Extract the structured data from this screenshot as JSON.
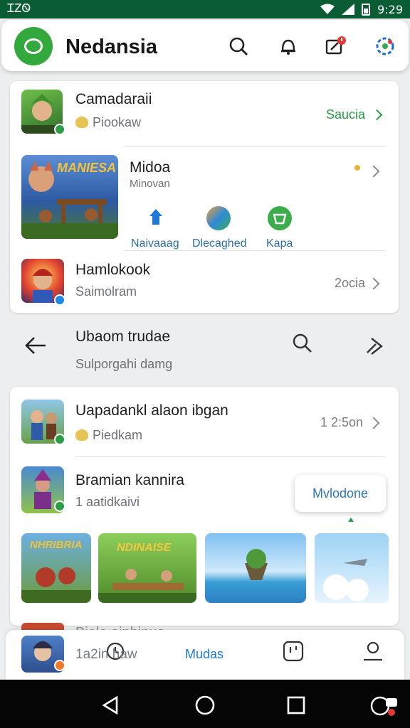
{
  "status": {
    "carrier": "ᏆᏃᏫ",
    "time": "9:29"
  },
  "header": {
    "title": "Nedansia"
  },
  "items": [
    {
      "title": "Camadaraii",
      "subtitle": "Piookaw",
      "action": "Saucia"
    },
    {
      "title": "Midoa",
      "subtitle": "Minovan",
      "actions": [
        "Naivaaag",
        "Dlecaghed",
        "Kapa"
      ],
      "banner": "MANIESA"
    },
    {
      "title": "Hamlokook",
      "subtitle": "Saimolram",
      "meta": "2ocia"
    }
  ],
  "search": {
    "title": "Ubaom trudae",
    "subtitle": "Sulporgahi damg"
  },
  "list2": [
    {
      "title": "Uapadankl alaon ibgan",
      "subtitle": "Piedkam",
      "meta": "1 2:5on"
    },
    {
      "title": "Bramian kannira",
      "subtitle": "1 aatidkaivi"
    }
  ],
  "tooltip": "Mvlodone",
  "gallery": [
    "NHRIBRIA",
    "NDINAISE",
    "",
    ""
  ],
  "partial_item": {
    "title": "Biolo ainbinua",
    "subtitle": "1a2in haw"
  },
  "bottom_nav": {
    "active": "Mudas"
  },
  "colors": {
    "brand_green": "#33a83d",
    "statusbar": "#0a5c35",
    "link_blue": "#2b6ea8",
    "accent_green": "#2a9c46"
  }
}
